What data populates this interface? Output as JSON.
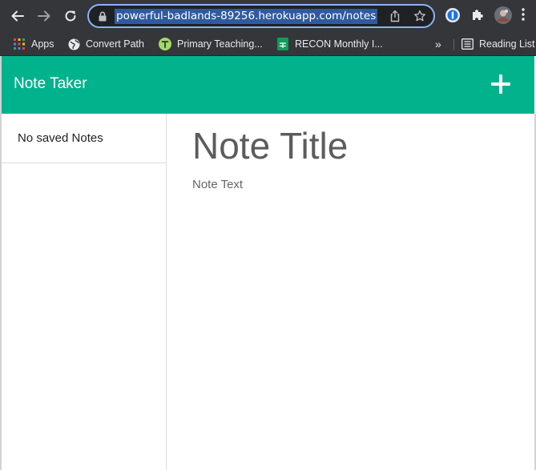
{
  "browser": {
    "url": "powerful-badlands-89256.herokuapp.com/notes",
    "icons": {
      "back": "arrow-left-icon",
      "forward": "arrow-right-icon",
      "reload": "reload-icon",
      "lock": "lock-icon",
      "share": "share-icon",
      "bookmark": "star-icon",
      "extension_password": "password-manager-icon",
      "extensions": "puzzle-icon",
      "profile": "avatar",
      "menu": "kebab-menu-icon"
    },
    "bookmarks": [
      {
        "label": "Apps",
        "icon": "apps-grid-icon"
      },
      {
        "label": "Convert Path",
        "icon": "globe-icon"
      },
      {
        "label": "Primary Teaching...",
        "icon": "primary-teaching-icon"
      },
      {
        "label": "RECON Monthly I...",
        "icon": "sheets-icon"
      }
    ],
    "overflow_label": "»",
    "reading_list_label": "Reading List"
  },
  "app": {
    "brand": "Note Taker",
    "add_icon": "plus-icon",
    "sidebar": {
      "empty_label": "No saved Notes"
    },
    "editor": {
      "title_placeholder": "Note Title",
      "text_placeholder": "Note Text"
    }
  },
  "colors": {
    "navbar": "#00b38c",
    "chrome": "#35363a",
    "omnibox_focus": "#8ab4f8",
    "url_selection": "#2f5b9e"
  }
}
